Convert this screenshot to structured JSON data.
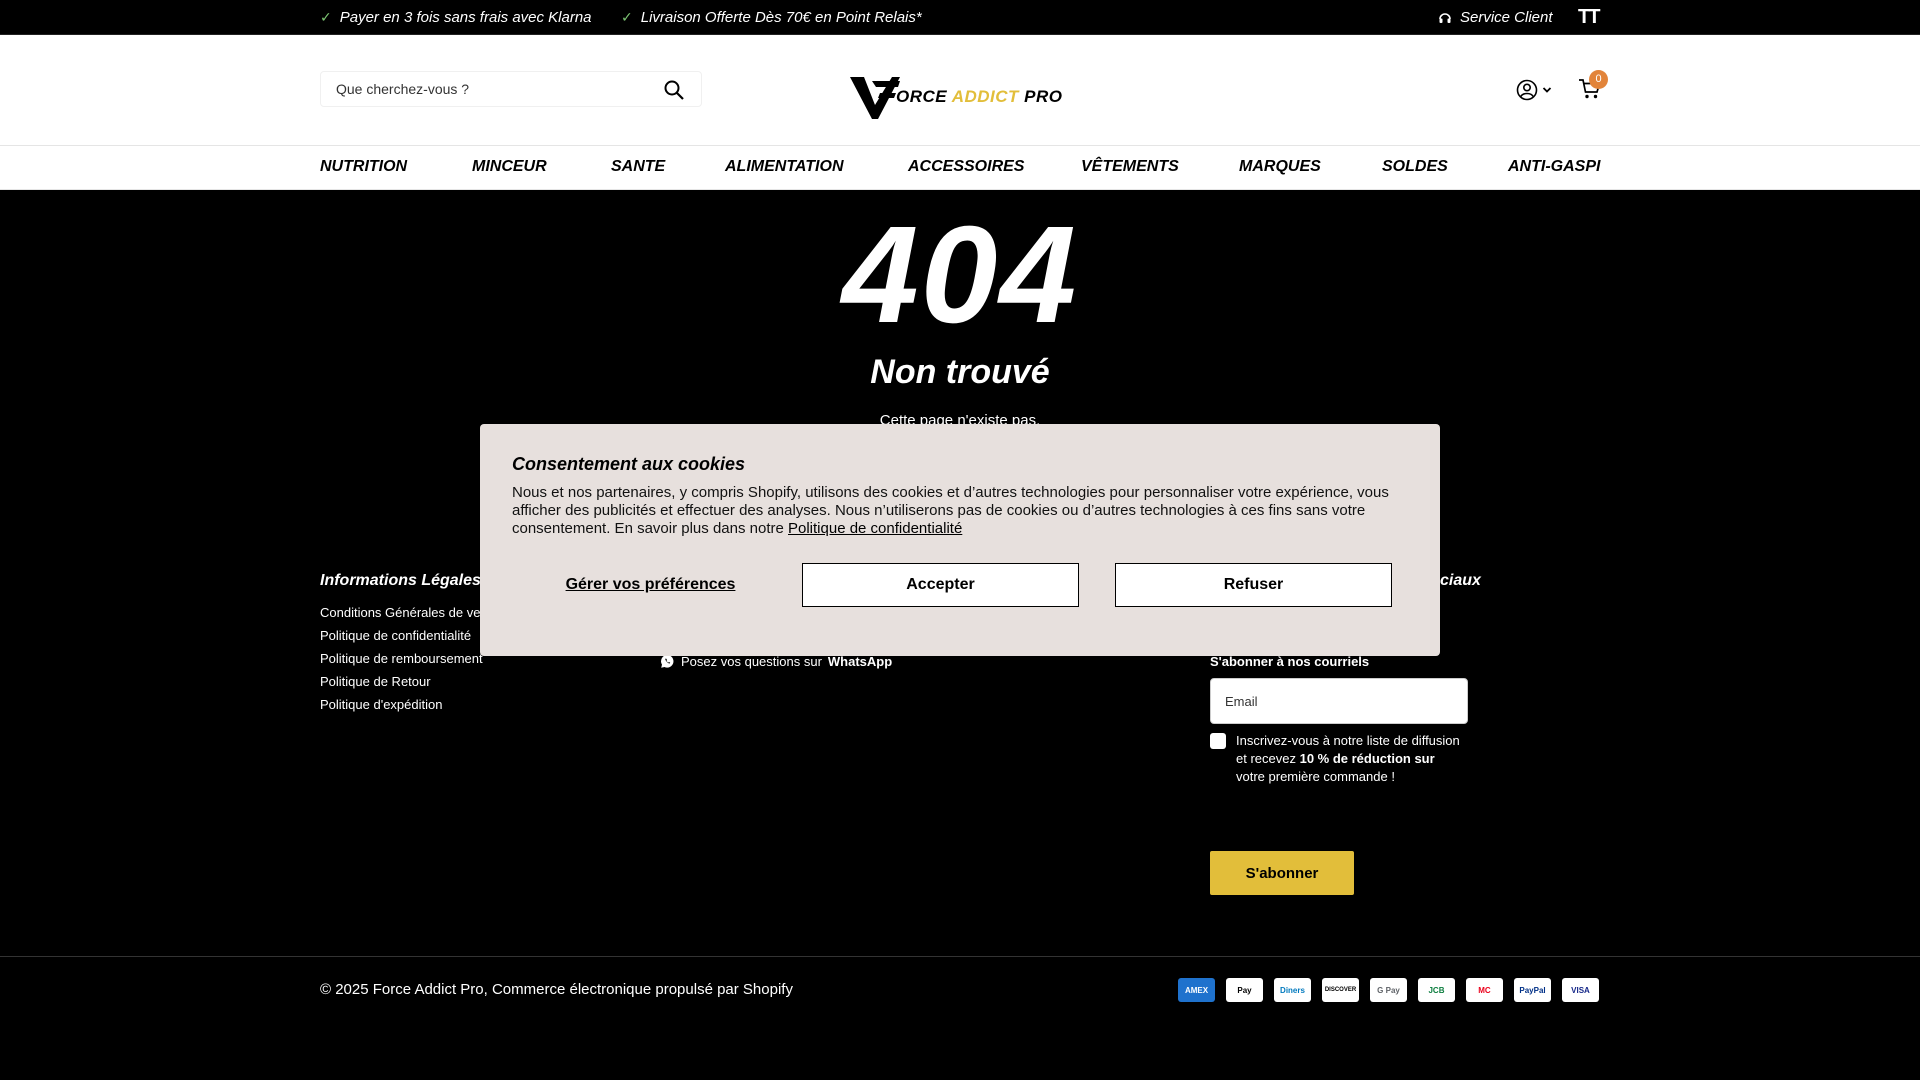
{
  "topbar": {
    "perks": [
      "Payer en 3 fois sans frais avec Klarna",
      "Livraison Offerte Dès 70€ en Point Relais*"
    ],
    "service": "Service Client",
    "text_size_label": "TT"
  },
  "header": {
    "search_placeholder": "Que cherchez-vous ?",
    "logo_text_1": "ORCE ",
    "logo_text_2": "ADDICT",
    "logo_text_3": " PRO",
    "cart_count": "0"
  },
  "nav": {
    "items": [
      "NUTRITION",
      "MINCEUR",
      "SANTE",
      "ALIMENTATION",
      "ACCESSOIRES",
      "VÊTEMENTS",
      "MARQUES",
      "SOLDES",
      "ANTI-GASPI"
    ]
  },
  "error": {
    "code": "404",
    "title": "Non trouvé",
    "message": "Cette page n'existe pas."
  },
  "footer": {
    "legal_title": "Informations Légales",
    "legal_links": [
      "Conditions Générales de vente",
      "Politique de confidentialité",
      "Politique de remboursement",
      "Politique de Retour",
      "Politique d'expédition"
    ],
    "social_title_fragment": "ciaux",
    "whatsapp_prefix": "Posez vos questions sur",
    "whatsapp_label": "WhatsApp",
    "newsletter_title": "S'abonner à nos courriels",
    "email_placeholder": "Email",
    "optin_text_1": "Inscrivez-vous à notre liste de diffusion et recevez ",
    "optin_bold": "10 % de réduction sur",
    "optin_text_2": " votre première commande !",
    "subscribe_label": "S'abonner"
  },
  "bottom": {
    "copyright": "© 2025 Force Addict Pro, Commerce électronique propulsé par Shopify",
    "payments": [
      "AMEX",
      "Pay",
      "Diners",
      "DISCOVER",
      "G Pay",
      "JCB",
      "MC",
      "PayPal",
      "VISA"
    ]
  },
  "cookie": {
    "title": "Consentement aux cookies",
    "body": "Nous et nos partenaires, y compris Shopify, utilisons des cookies et d’autres technologies pour personnaliser votre expérience, vous afficher des publicités et effectuer des analyses. Nous n’utiliserons pas de cookies ou d’autres technologies à ces fins sans votre consentement. En savoir plus dans notre ",
    "policy_link": "Politique de confidentialité",
    "prefs_label": "Gérer vos préférences",
    "accept_label": "Accepter",
    "refuse_label": "Refuser"
  },
  "colors": {
    "accent": "#e2be3a",
    "check": "#7cc472",
    "badge": "#e2843a",
    "modal_bg": "#e7e0dd"
  }
}
